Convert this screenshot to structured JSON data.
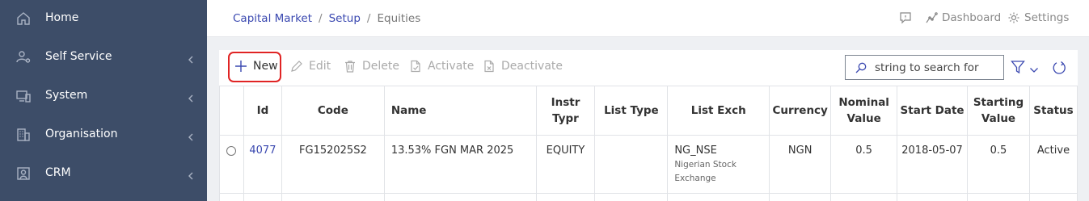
{
  "sidebar": {
    "items": [
      {
        "label": "Home",
        "icon": "home-icon",
        "expandable": false
      },
      {
        "label": "Self Service",
        "icon": "user-settings-icon",
        "expandable": true
      },
      {
        "label": "System",
        "icon": "devices-icon",
        "expandable": true
      },
      {
        "label": "Organisation",
        "icon": "building-icon",
        "expandable": true
      },
      {
        "label": "CRM",
        "icon": "contact-icon",
        "expandable": true
      }
    ]
  },
  "header": {
    "breadcrumb": [
      "Capital Market",
      "Setup",
      "Equities"
    ],
    "feedback_icon": "feedback-icon",
    "dashboard_label": "Dashboard",
    "settings_label": "Settings"
  },
  "toolbar": {
    "new_label": "New",
    "edit_label": "Edit",
    "delete_label": "Delete",
    "activate_label": "Activate",
    "deactivate_label": "Deactivate",
    "search_placeholder": "string to search for"
  },
  "table": {
    "columns": [
      "",
      "Id",
      "Code",
      "Name",
      "Instr Typr",
      "List Type",
      "List Exch",
      "Currency",
      "Nominal Value",
      "Start Date",
      "Starting Value",
      "Status"
    ],
    "rows": [
      {
        "id": "4077",
        "code": "FG152025S2",
        "name": "13.53% FGN MAR 2025",
        "instr_type": "EQUITY",
        "list_type": "",
        "list_exch": "NG_NSE",
        "list_exch_desc": "Nigerian Stock Exchange",
        "currency": "NGN",
        "nominal_value": "0.5",
        "start_date": "2018-05-07",
        "starting_value": "0.5",
        "status": "Active"
      }
    ]
  },
  "colors": {
    "sidebar_bg": "#3d4d68",
    "link": "#3a48b0",
    "highlight": "#e02424"
  }
}
